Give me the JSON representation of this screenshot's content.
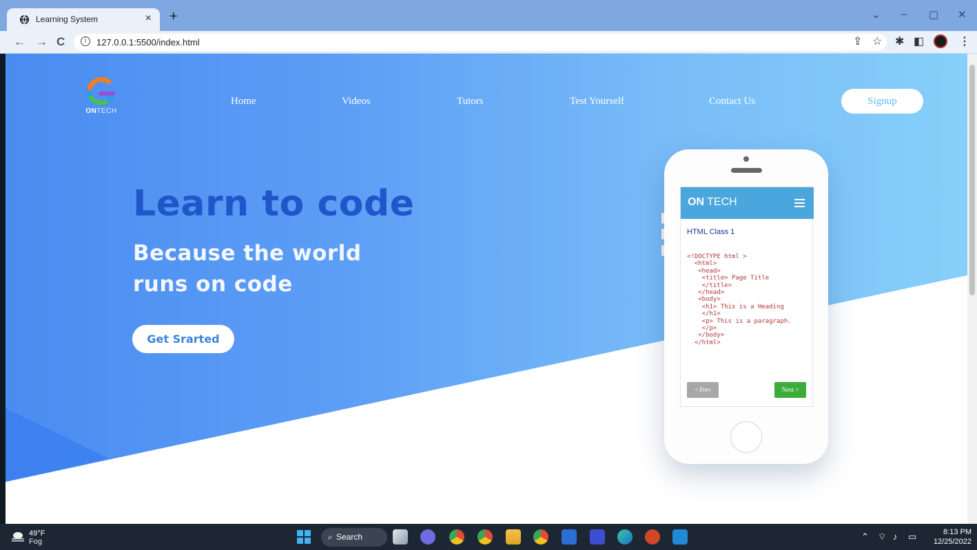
{
  "browser": {
    "tab_title": "Learning System",
    "tab_close": "×",
    "new_tab": "+",
    "url": "127.0.0.1:5500/index.html",
    "back": "←",
    "forward": "→",
    "reload": "C",
    "controls": {
      "chevron": "⌄",
      "minimize": "–",
      "restore": "▢",
      "close": "✕"
    },
    "toolbar_icons": [
      "share-icon",
      "star-icon",
      "extensions-icon",
      "side-panel-icon",
      "profile-avatar",
      "menu-icon"
    ]
  },
  "site": {
    "logo_word_bold": "ON",
    "logo_word_light": "TECH",
    "nav": [
      "Home",
      "Videos",
      "Tutors",
      "Test Yourself",
      "Contact Us"
    ],
    "signup": "Signup",
    "headline": "Learn to code",
    "subheadline": "Because the world runs on code",
    "cta": "Get Srarted",
    "phone": {
      "brand_bold": "ON",
      "brand_light": " TECH",
      "lesson_title": "HTML Class 1",
      "code": "<!DOCTYPE html >\n  <html>\n   <head>\n    <title> Page Title\n    </title>\n   </head>\n   <body>\n    <h1> This is a Heading\n    </h1>\n    <p> This is a paragraph.\n    </p>\n   </body>\n  </html>",
      "prev": "< Prev",
      "next": "Next >"
    }
  },
  "taskbar": {
    "temperature": "49°F",
    "condition": "Fog",
    "search": "Search",
    "time": "8:13 PM",
    "date": "12/25/2022",
    "apps": [
      "start-icon",
      "task-view-icon",
      "chat-icon",
      "chrome-icon",
      "chrome-canary-icon",
      "file-explorer-icon",
      "chrome-dev-icon",
      "store-icon",
      "zoom-like-icon",
      "edge-icon",
      "powerpoint-icon",
      "vscode-icon"
    ]
  },
  "colors": {
    "page_blue_left": "#4a8cf0",
    "page_blue_right": "#86cff9",
    "headline": "#1f56c9",
    "phone_header": "#4aa6dc",
    "next_button": "#3bac38"
  }
}
